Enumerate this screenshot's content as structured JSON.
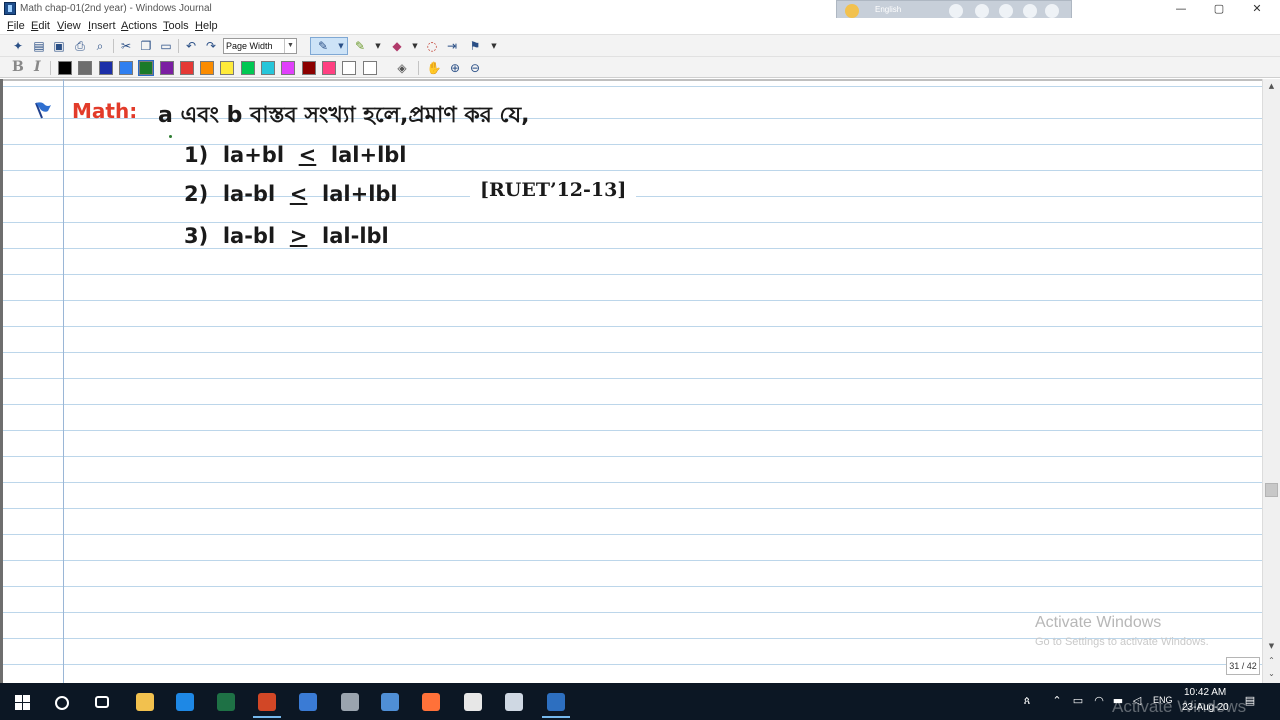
{
  "window": {
    "title": "Math chap-01(2nd year) - Windows Journal",
    "language": "English",
    "controls": {
      "minimize": "—",
      "maximize": "▢",
      "close": "✕"
    }
  },
  "menu": {
    "items": [
      {
        "key": "file",
        "label": "File"
      },
      {
        "key": "edit",
        "label": "Edit"
      },
      {
        "key": "view",
        "label": "View"
      },
      {
        "key": "insert",
        "label": "Insert"
      },
      {
        "key": "actions",
        "label": "Actions"
      },
      {
        "key": "tools",
        "label": "Tools"
      },
      {
        "key": "help",
        "label": "Help"
      }
    ]
  },
  "toolbar": {
    "zoom_value": "Page Width",
    "bold_label": "B",
    "italic_label": "I",
    "colors": [
      "#000000",
      "#6d6d6d",
      "#1c2fa8",
      "#2f7ff0",
      "#1a7a2a",
      "#7b1fa2",
      "#e53935",
      "#fb8c00",
      "#ffeb3b",
      "#00c853",
      "#26c6da",
      "#e040fb",
      "#8b0000",
      "#ff4081",
      "#ffffff",
      "#ffffff"
    ],
    "selected_color": "#1a7a2a"
  },
  "note": {
    "heading_label": "Math:",
    "heading_color": "#e23b2a",
    "statement": "a এবং b বাস্তব সংখ্যা হলে,প্রমাণ কর যে,",
    "inequalities": [
      {
        "number": "1)",
        "left": "la+bl",
        "op": "<",
        "right": "lal+lbl"
      },
      {
        "number": "2)",
        "left": "la-bl",
        "op": "<",
        "right": "lal+lbl"
      },
      {
        "number": "3)",
        "left": "la-bl",
        "op": ">",
        "right": "lal-lbl"
      }
    ],
    "source_tag": "[RUET’12-13]"
  },
  "status": {
    "page_counter": "31 / 42"
  },
  "watermark": {
    "title": "Activate Windows",
    "subtitle": "Go to Settings to activate Windows."
  },
  "taskbar": {
    "lang": "ENG",
    "time": "10:42 AM",
    "date": "23-Aug-20",
    "watermark": "Activate Windows",
    "apps": [
      {
        "key": "file-explorer",
        "color": "#f2c14e"
      },
      {
        "key": "edge",
        "color": "#1e88e5"
      },
      {
        "key": "excel",
        "color": "#1e7145"
      },
      {
        "key": "powerpoint",
        "color": "#d24726"
      },
      {
        "key": "store",
        "color": "#3a7bd5"
      },
      {
        "key": "camera",
        "color": "#9aa4ae"
      },
      {
        "key": "journal-taskbar",
        "color": "#4f8fd6"
      },
      {
        "key": "firefox",
        "color": "#ff7139"
      },
      {
        "key": "paint",
        "color": "#e7e7e7"
      },
      {
        "key": "notepad",
        "color": "#cfd8e3"
      },
      {
        "key": "windows-journal",
        "color": "#2d6fc0"
      }
    ]
  }
}
